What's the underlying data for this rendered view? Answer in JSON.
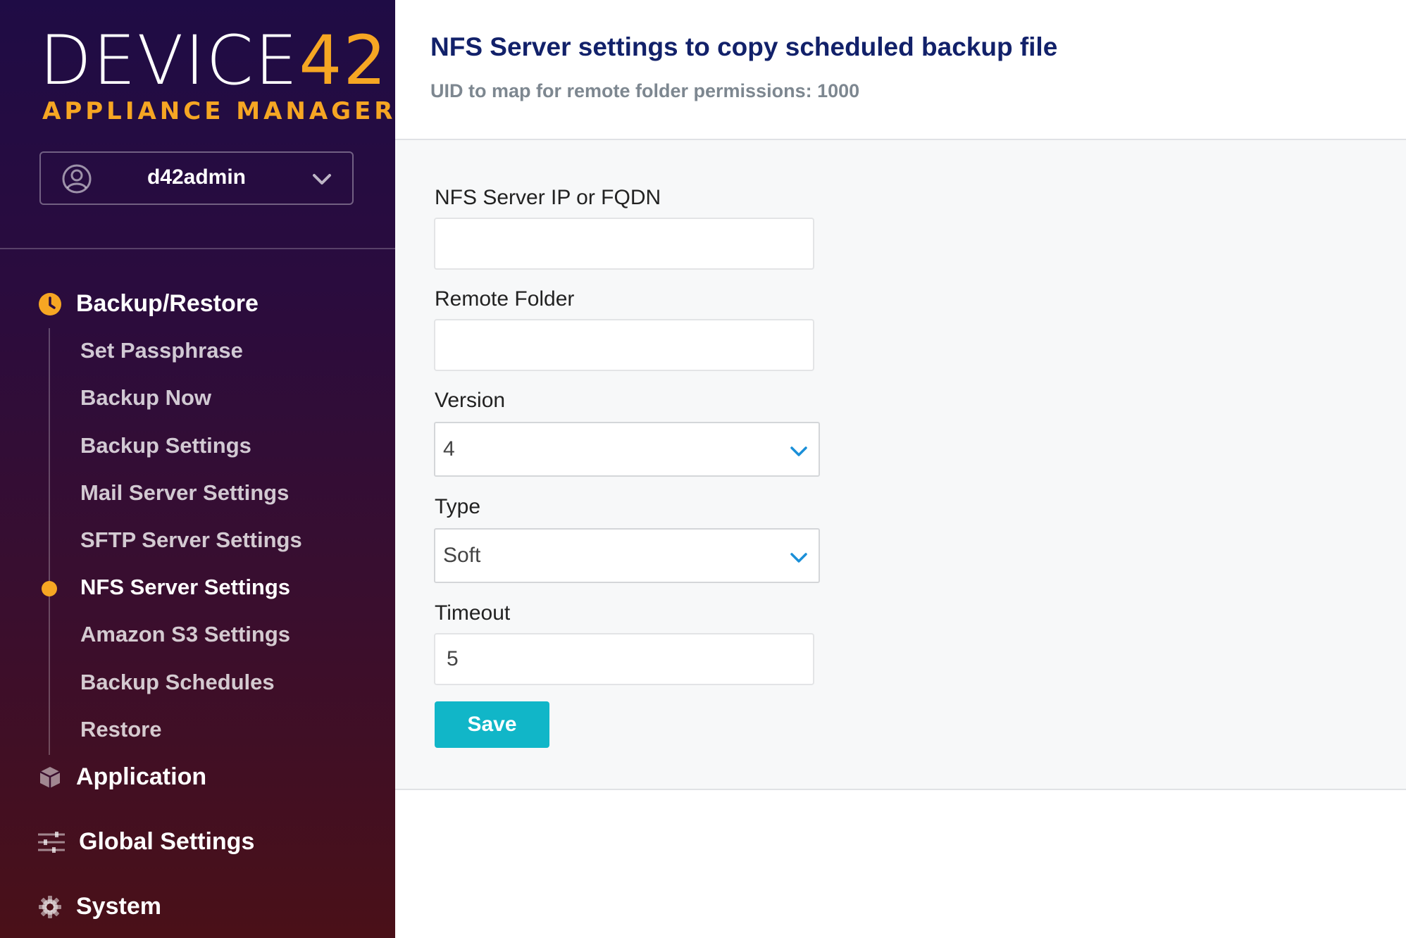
{
  "brand": {
    "logo_text": "DEVICE",
    "logo_number": "42",
    "subtitle": "APPLIANCE MANAGER",
    "accent_color": "#f6a623"
  },
  "user": {
    "name": "d42admin",
    "icon": "user-circle-icon",
    "menu_icon": "chevron-down-icon"
  },
  "nav": {
    "backup_restore": {
      "label": "Backup/Restore",
      "icon": "clock-icon",
      "items": [
        {
          "label": "Set Passphrase",
          "active": false
        },
        {
          "label": "Backup Now",
          "active": false
        },
        {
          "label": "Backup Settings",
          "active": false
        },
        {
          "label": "Mail Server Settings",
          "active": false
        },
        {
          "label": "SFTP Server Settings",
          "active": false
        },
        {
          "label": "NFS Server Settings",
          "active": true
        },
        {
          "label": "Amazon S3 Settings",
          "active": false
        },
        {
          "label": "Backup Schedules",
          "active": false
        },
        {
          "label": "Restore",
          "active": false
        }
      ]
    },
    "application": {
      "label": "Application",
      "icon": "cube-icon"
    },
    "global_settings": {
      "label": "Global Settings",
      "icon": "sliders-icon"
    },
    "system": {
      "label": "System",
      "icon": "gear-icon"
    }
  },
  "page": {
    "title": "NFS Server settings to copy scheduled backup file",
    "subtitle": "UID to map for remote folder permissions: 1000"
  },
  "form": {
    "server": {
      "label": "NFS Server IP or FQDN",
      "value": ""
    },
    "remote_folder": {
      "label": "Remote Folder",
      "value": ""
    },
    "version": {
      "label": "Version",
      "value": "4"
    },
    "type": {
      "label": "Type",
      "value": "Soft"
    },
    "timeout": {
      "label": "Timeout",
      "value": "5"
    },
    "save_label": "Save",
    "button_color": "#11b6c8"
  }
}
